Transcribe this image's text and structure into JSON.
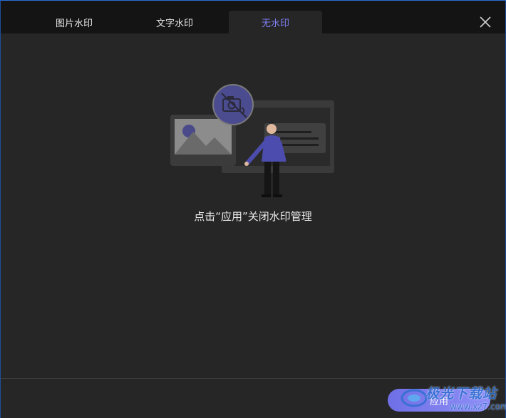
{
  "tabs": [
    {
      "label": "图片水印"
    },
    {
      "label": "文字水印"
    },
    {
      "label": "无水印"
    }
  ],
  "active_tab": "无水印",
  "message": "点击“应用”关闭水印管理",
  "apply_button": {
    "label": "应用"
  },
  "watermark": {
    "name": "极光下载站",
    "url": "www.xz7.com"
  },
  "colors": {
    "accent": "#7f7ff2",
    "background": "#262626",
    "tabbar": "#141414"
  },
  "icons": [
    "close-icon",
    "no-camera-icon"
  ]
}
